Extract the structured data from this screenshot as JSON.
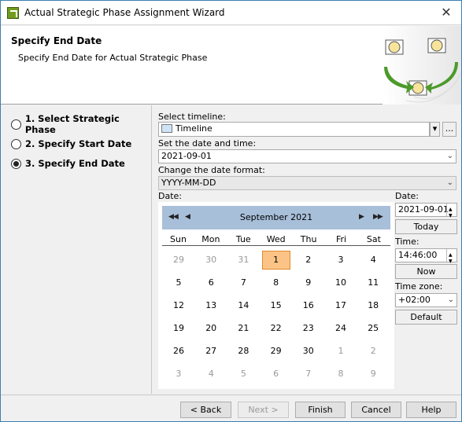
{
  "window": {
    "title": "Actual Strategic Phase Assignment Wizard",
    "close_label": "✕"
  },
  "header": {
    "title": "Specify End Date",
    "subtitle": "Specify End Date for Actual Strategic Phase"
  },
  "steps": [
    {
      "label": "1. Select Strategic Phase",
      "selected": false
    },
    {
      "label": "2. Specify Start Date",
      "selected": false
    },
    {
      "label": "3. Specify End Date",
      "selected": true
    }
  ],
  "form": {
    "timeline_label": "Select timeline:",
    "timeline_value": "Timeline",
    "browse_label": "...",
    "datetime_label": "Set the date and time:",
    "datetime_value": "2021-09-01",
    "format_label": "Change the date format:",
    "format_value": "YYYY-MM-DD",
    "date_label": "Date:"
  },
  "calendar": {
    "month_label": "September  2021",
    "weekdays": [
      "Sun",
      "Mon",
      "Tue",
      "Wed",
      "Thu",
      "Fri",
      "Sat"
    ],
    "weeks": [
      [
        "29",
        "30",
        "31",
        "1",
        "2",
        "3",
        "4"
      ],
      [
        "5",
        "6",
        "7",
        "8",
        "9",
        "10",
        "11"
      ],
      [
        "12",
        "13",
        "14",
        "15",
        "16",
        "17",
        "18"
      ],
      [
        "19",
        "20",
        "21",
        "22",
        "23",
        "24",
        "25"
      ],
      [
        "26",
        "27",
        "28",
        "29",
        "30",
        "1",
        "2"
      ],
      [
        "3",
        "4",
        "5",
        "6",
        "7",
        "8",
        "9"
      ]
    ],
    "selected_day": "1"
  },
  "side": {
    "date_label": "Date:",
    "date_value": "2021-09-01",
    "today_label": "Today",
    "time_label": "Time:",
    "time_value": "14:46:00",
    "now_label": "Now",
    "tz_label": "Time zone:",
    "tz_value": "+02:00",
    "default_label": "Default"
  },
  "footer": {
    "back_label": "< Back",
    "next_label": "Next >",
    "finish_label": "Finish",
    "cancel_label": "Cancel",
    "help_label": "Help"
  },
  "colors": {
    "accent": "#3c7fb1",
    "calendar_header": "#a8bfd9",
    "selected_day": "#fbc486"
  }
}
